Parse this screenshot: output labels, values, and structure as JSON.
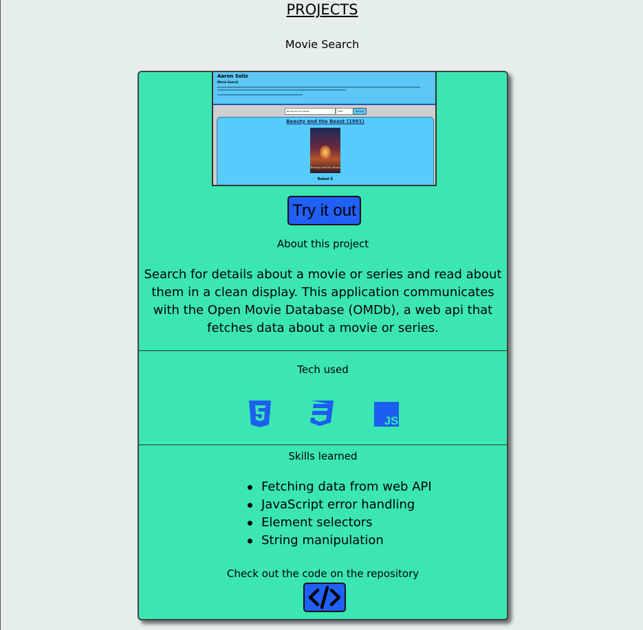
{
  "page": {
    "title": "PROJECTS"
  },
  "project": {
    "name": "Movie Search",
    "thumbnail": {
      "author": "Aaron Soliz",
      "app_title": "Movie Search",
      "search_value": "Beauty and the Beast",
      "year_value": "1991",
      "search_button": "Get Film",
      "movie_title": "Beauty and the Beast (1991)",
      "poster_text": "Beauty and the Beast",
      "rating": "Rated G"
    },
    "try_button": "Try it out",
    "about_heading": "About this project",
    "about_text": "Search for details about a movie or series and read about them in a clean display. This application communicates with the Open Movie Database (OMDb), a web api that fetches data about a movie or series.",
    "tech_heading": "Tech used",
    "tech_icons": [
      "html5-icon",
      "css3-icon",
      "javascript-icon"
    ],
    "skills_heading": "Skills learned",
    "skills": [
      "Fetching data from web API",
      "JavaScript error handling",
      "Element selectors",
      "String manipulation"
    ],
    "repo_heading": "Check out the code on the repository",
    "repo_icon": "code-icon"
  },
  "colors": {
    "background": "#e6eeec",
    "card": "#3be6b2",
    "button": "#2160f5",
    "icon": "#1b5ef0"
  }
}
